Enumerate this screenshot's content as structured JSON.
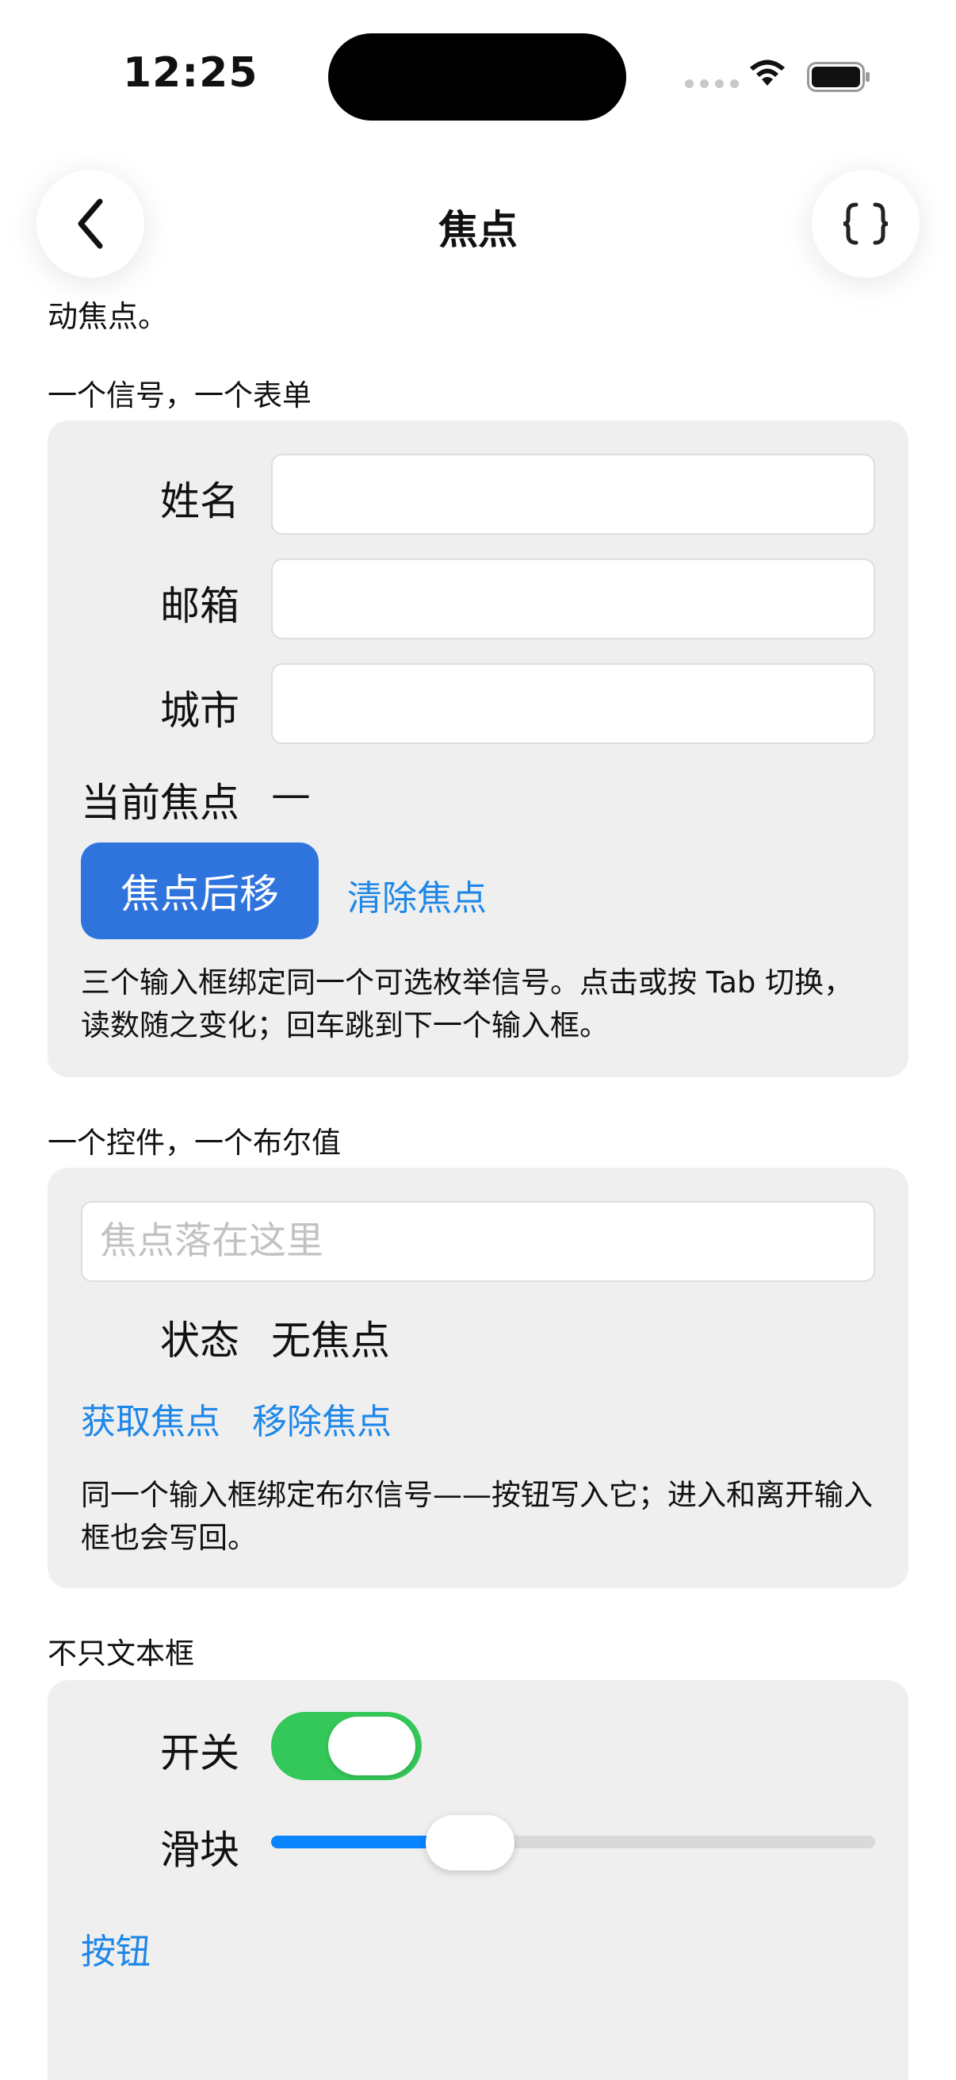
{
  "status_bar": {
    "time": "12:25"
  },
  "nav": {
    "title": "焦点"
  },
  "intro_tail": "动焦点。",
  "section1": {
    "title": "一个信号，一个表单",
    "fields": [
      {
        "label": "姓名",
        "value": ""
      },
      {
        "label": "邮箱",
        "value": ""
      },
      {
        "label": "城市",
        "value": ""
      }
    ],
    "current_focus_label": "当前焦点",
    "current_focus_value": "—",
    "primary_button": "焦点后移",
    "clear_link": "清除焦点",
    "note": "三个输入框绑定同一个可选枚举信号。点击或按 Tab 切换，读数随之变化；回车跳到下一个输入框。"
  },
  "section2": {
    "title": "一个控件，一个布尔值",
    "input_placeholder": "焦点落在这里",
    "status_label": "状态",
    "status_value": "无焦点",
    "focus_link": "获取焦点",
    "blur_link": "移除焦点",
    "note": "同一个输入框绑定布尔信号——按钮写入它；进入和离开输入框也会写回。"
  },
  "section3": {
    "title": "不只文本框",
    "toggle_label": "开关",
    "toggle_on": true,
    "slider_label": "滑块",
    "slider_value": 0.33,
    "button_link": "按钮"
  },
  "colors": {
    "accent": "#1e87e8",
    "primary_button": "#2f73dd",
    "toggle_on": "#34c759",
    "slider_fill": "#0a84ff",
    "card_bg": "#efefef"
  },
  "icons": [
    "chevron-left-icon",
    "braces-icon",
    "wifi-icon",
    "battery-icon",
    "signal-dots-icon"
  ]
}
